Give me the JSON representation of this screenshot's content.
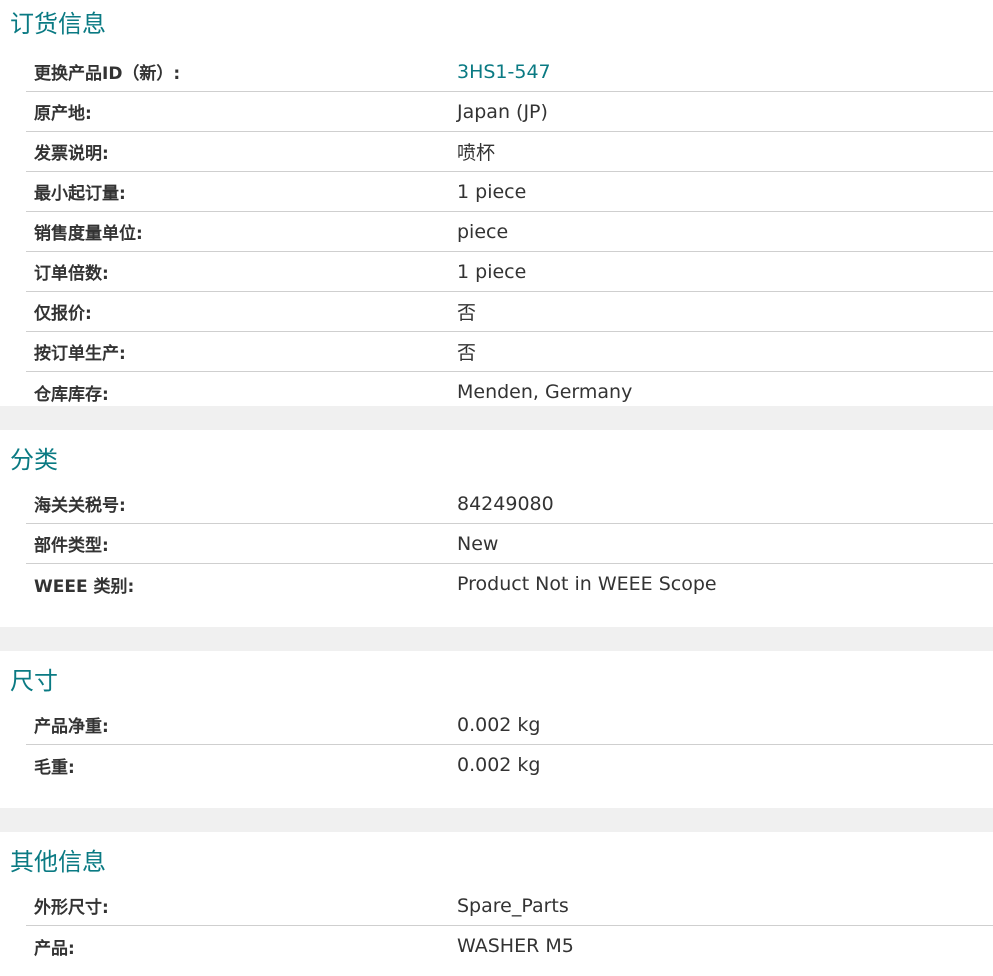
{
  "sections": [
    {
      "title": "订货信息",
      "rows": [
        {
          "label": "更换产品ID（新）:",
          "value": "3HS1-547"
        },
        {
          "label": "原产地:",
          "value": "Japan (JP)"
        },
        {
          "label": "发票说明:",
          "value": "喷杯"
        },
        {
          "label": "最小起订量:",
          "value": "1 piece"
        },
        {
          "label": "销售度量单位:",
          "value": "piece"
        },
        {
          "label": "订单倍数:",
          "value": "1 piece"
        },
        {
          "label": "仅报价:",
          "value": "否"
        },
        {
          "label": "按订单生产:",
          "value": "否"
        },
        {
          "label": "仓库库存:",
          "value": "Menden, Germany"
        }
      ]
    },
    {
      "title": "分类",
      "rows": [
        {
          "label": "海关关税号:",
          "value": "84249080"
        },
        {
          "label": "部件类型:",
          "value": "New"
        },
        {
          "label": "WEEE 类别:",
          "value": "Product Not in WEEE Scope"
        }
      ]
    },
    {
      "title": "尺寸",
      "rows": [
        {
          "label": "产品净重:",
          "value": "0.002 kg"
        },
        {
          "label": "毛重:",
          "value": "0.002 kg"
        }
      ]
    },
    {
      "title": "其他信息",
      "rows": [
        {
          "label": "外形尺寸:",
          "value": "Spare_Parts"
        },
        {
          "label": "产品:",
          "value": "WASHER M5"
        }
      ]
    }
  ],
  "colors": {
    "accent": "#0a7a83",
    "divider": "#cfcfcf",
    "gap": "#f0f0f0"
  }
}
